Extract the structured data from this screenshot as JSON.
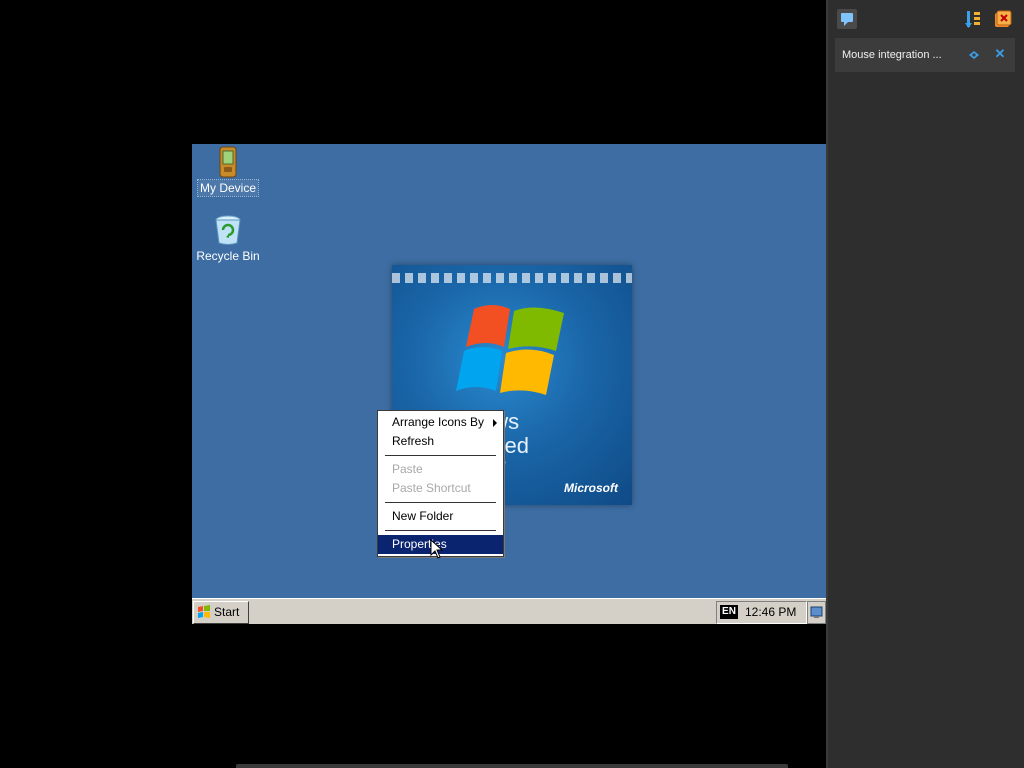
{
  "desktop": {
    "icons": [
      {
        "label": "My Device",
        "icon": "handheld-device-icon"
      },
      {
        "label": "Recycle Bin",
        "icon": "recycle-bin-icon"
      }
    ],
    "wallpaper": {
      "text_line1": "ows",
      "text_line2": "dded",
      "text_line3": "t 7",
      "brand": "Microsoft"
    }
  },
  "context_menu": {
    "items": [
      {
        "label": "Arrange Icons By",
        "state": "enabled",
        "submenu": true
      },
      {
        "label": "Refresh",
        "state": "enabled"
      },
      {
        "label": "Paste",
        "state": "disabled"
      },
      {
        "label": "Paste Shortcut",
        "state": "disabled"
      },
      {
        "label": "New Folder",
        "state": "enabled"
      },
      {
        "label": "Properties",
        "state": "highlighted"
      }
    ]
  },
  "taskbar": {
    "start_label": "Start",
    "language": "EN",
    "clock": "12:46 PM"
  },
  "host_panel": {
    "notification_text": "Mouse integration ...",
    "close_glyph": "✕"
  },
  "colors": {
    "desktop_bg": "#3d6da3",
    "menu_highlight": "#0a2470",
    "taskbar_bg": "#d4d0c8",
    "host_panel_bg": "#2e2e2e",
    "accent_blue": "#3aa0e8"
  }
}
